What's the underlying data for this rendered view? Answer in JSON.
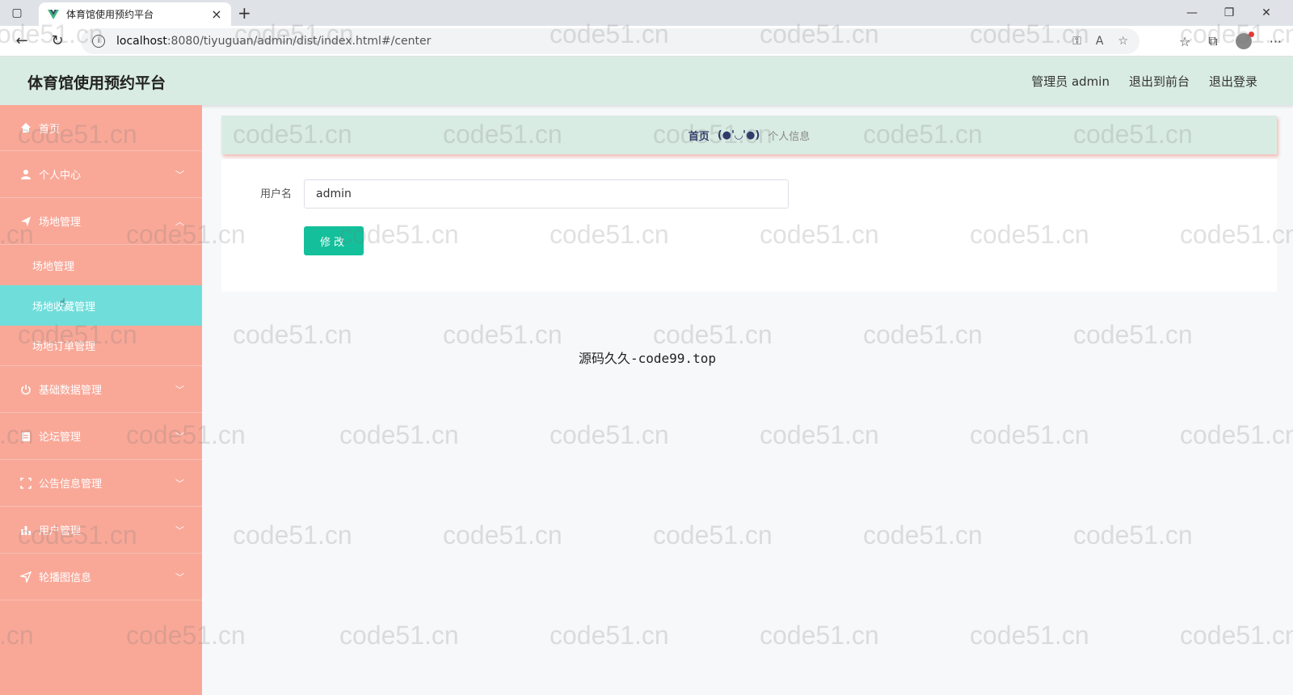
{
  "browser": {
    "tab_title": "体育馆使用预约平台",
    "tab_close": "×",
    "new_tab": "+",
    "url_host": "localhost",
    "url_rest": ":8080/tiyuguan/admin/dist/index.html#/center"
  },
  "header": {
    "title": "体育馆使用预约平台",
    "admin_label": "管理员 admin",
    "to_front": "退出到前台",
    "logout": "退出登录"
  },
  "sidebar": {
    "items": [
      {
        "label": "首页",
        "icon": "home-icon"
      },
      {
        "label": "个人中心",
        "icon": "user-icon"
      },
      {
        "label": "场地管理",
        "icon": "send-icon"
      },
      {
        "label": "基础数据管理",
        "icon": "power-icon"
      },
      {
        "label": "论坛管理",
        "icon": "forum-icon"
      },
      {
        "label": "公告信息管理",
        "icon": "frame-icon"
      },
      {
        "label": "用户管理",
        "icon": "bar-chart-icon"
      },
      {
        "label": "轮播图信息",
        "icon": "navigation-icon"
      }
    ],
    "sub_items": [
      "场地管理",
      "场地收藏管理",
      "场地订单管理"
    ]
  },
  "breadcrumb": {
    "home": "首页",
    "separator": "(●'◡'●)",
    "current": "个人信息"
  },
  "form": {
    "username_label": "用户名",
    "username_value": "admin",
    "submit_label": "修改"
  },
  "center_text": "源码久久-code99.top",
  "watermark": "code51.cn",
  "colors": {
    "sidebar_bg": "#f9a898",
    "active_item": "#6fdedb",
    "header_bg": "#d9ece3",
    "button": "#13c09b"
  }
}
